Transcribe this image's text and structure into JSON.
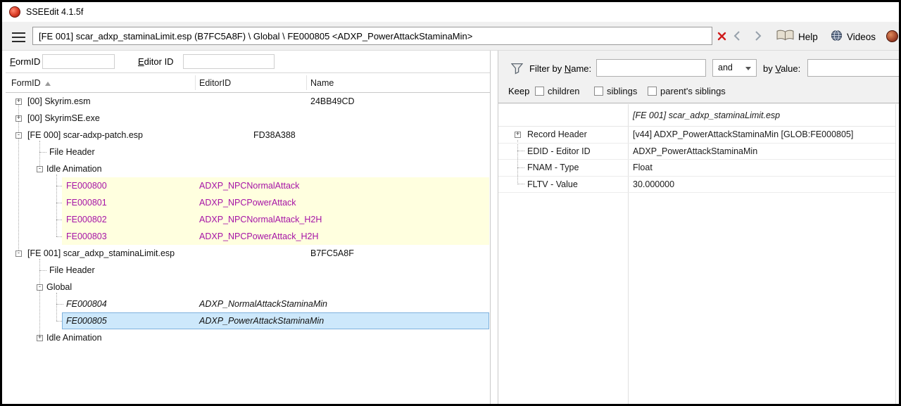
{
  "window": {
    "title": "SSEEdit 4.1.5f"
  },
  "toolbar": {
    "path": "[FE 001] scar_adxp_staminaLimit.esp (B7FC5A8F) \\ Global \\ FE000805 <ADXP_PowerAttackStaminaMin>",
    "help": "Help",
    "videos": "Videos"
  },
  "left": {
    "formid_accel": "F",
    "formid_rest": "ormID",
    "formid_value": "",
    "editorid_accel": "E",
    "editorid_rest": "ditor ID",
    "editorid_value": ""
  },
  "columns": {
    "formid": "FormID",
    "editorid": "EditorID",
    "name": "Name"
  },
  "tree": {
    "rows": [
      {
        "exp": "+",
        "formid": "[00] Skyrim.esm",
        "editorid": "",
        "name": "24BB49CD"
      },
      {
        "exp": "+",
        "formid": "[00] SkyrimSE.exe",
        "editorid": "",
        "name": ""
      },
      {
        "exp": "-",
        "formid": "[FE 000] scar-adxp-patch.esp",
        "editorid": "FD38A388",
        "name": ""
      },
      {
        "formid": "File Header"
      },
      {
        "exp": "-",
        "formid": "Idle Animation"
      },
      {
        "formid": "FE000800",
        "editorid": "ADXP_NPCNormalAttack"
      },
      {
        "formid": "FE000801",
        "editorid": "ADXP_NPCPowerAttack"
      },
      {
        "formid": "FE000802",
        "editorid": "ADXP_NPCNormalAttack_H2H"
      },
      {
        "formid": "FE000803",
        "editorid": "ADXP_NPCPowerAttack_H2H"
      },
      {
        "exp": "-",
        "formid": "[FE 001] scar_adxp_staminaLimit.esp",
        "editorid": "",
        "name": "B7FC5A8F"
      },
      {
        "formid": "File Header"
      },
      {
        "exp": "-",
        "formid": "Global"
      },
      {
        "formid": "FE000804",
        "editorid": "ADXP_NormalAttackStaminaMin"
      },
      {
        "formid": "FE000805",
        "editorid": "ADXP_PowerAttackStaminaMin"
      },
      {
        "exp": "+",
        "formid": "Idle Animation"
      }
    ]
  },
  "right": {
    "filter_pre": "Filter by ",
    "filter_accel": "N",
    "filter_post": "ame:",
    "name_filter_value": "",
    "and_value": "and",
    "value_pre": "by ",
    "value_accel": "V",
    "value_post": "alue:",
    "value_filter_value": "",
    "keep": "Keep",
    "keep_options": [
      "children",
      "siblings",
      "parent's siblings"
    ],
    "record": {
      "plugin": "[FE 001] scar_adxp_staminaLimit.esp",
      "rows": [
        {
          "field": "Record Header",
          "value": "[v44] ADXP_PowerAttackStaminaMin [GLOB:FE000805]"
        },
        {
          "field": "EDID - Editor ID",
          "value": "ADXP_PowerAttackStaminaMin"
        },
        {
          "field": "FNAM - Type",
          "value": "Float"
        },
        {
          "field": "FLTV - Value",
          "value": "30.000000"
        }
      ]
    }
  },
  "colors": {
    "selection_bg": "#cde8fb",
    "new_record_bg": "#ffffdf",
    "new_record_text": "#a613a6",
    "clear_icon": "#cf1b1b"
  }
}
